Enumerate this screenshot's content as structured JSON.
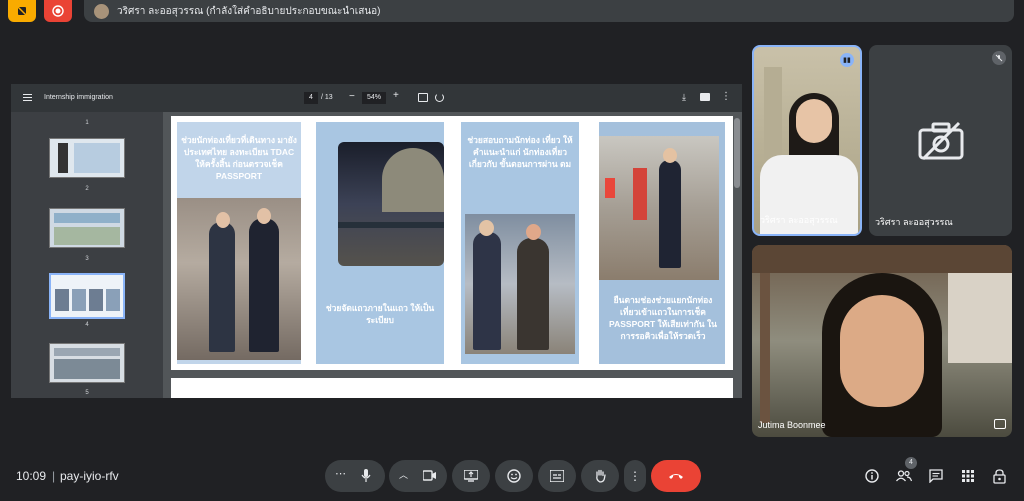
{
  "topbar": {
    "presenter_text": "วริศรา ละออสุวรรณ (กำลังใส่คำอธิบายประกอบขณะนำเสนอ)"
  },
  "pdf": {
    "title": "Internship immigration",
    "page_current": "4",
    "page_total": "/ 13",
    "zoom": "54%",
    "thumbnails": [
      "1",
      "2",
      "3",
      "4",
      "5"
    ],
    "cards": [
      {
        "text": "ช่วยนักท่องเที่ยวที่เดินทาง มายังประเทศไทย ลงทะเบียน TDAC ให้ครั้งสิ้น ก่อนตรวจเช็ค PASSPORT"
      },
      {
        "text": "ช่วยจัดแถวภายในแถว ให้เป็นระเบียบ"
      },
      {
        "text": "ช่วยสอบถามนักท่อง เที่ยว ให้คำแนะนำแก่ นักท่องเที่ยวเกี่ยวกับ ขั้นตอนการผ่าน ตม"
      },
      {
        "text": "ยืนตามช่องช่วยแยกนักท่อง เที่ยวเข้าแถวในการเช็ค PASSPORT ให้เสียเท่ากัน ในการรอคิวเพื่อให้รวดเร็ว"
      }
    ]
  },
  "participants": [
    {
      "name": "วริศรา ละออสุวรรณ"
    },
    {
      "name": "วริศรา ละออสุวรรณ"
    },
    {
      "name": "Jutima Boonmee"
    }
  ],
  "bottom": {
    "time": "10:09",
    "meeting_code": "pay-iyio-rfv",
    "people_badge": "4"
  },
  "colors": {
    "background": "#202124",
    "end_call": "#ea4335",
    "accent": "#8ab4f8"
  }
}
